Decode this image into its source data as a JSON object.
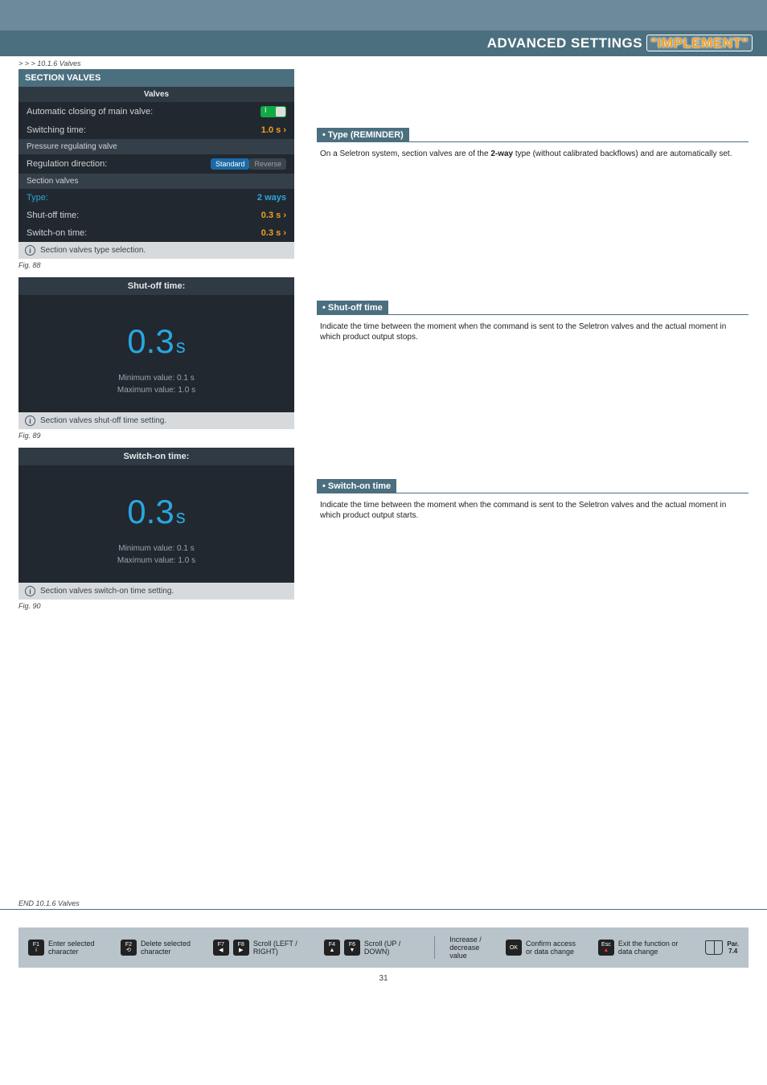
{
  "header": {
    "title_pre": "ADVANCED SETTINGS ",
    "title_impl": "\"IMPLEMENT\""
  },
  "breadcrumb": "> > > 10.1.6 Valves",
  "section_title": "SECTION VALVES",
  "panel": {
    "valves_hdr": "Valves",
    "auto_close": {
      "label": "Automatic closing of main valve:"
    },
    "switch_time": {
      "label": "Switching time:",
      "value": "1.0 s"
    },
    "prv_hdr": "Pressure regulating valve",
    "reg_dir": {
      "label": "Regulation direction:",
      "opt_on": "Standard",
      "opt_off": "Reverse"
    },
    "sv_hdr": "Section valves",
    "type": {
      "label": "Type:",
      "value": "2 ways"
    },
    "shutoff": {
      "label": "Shut-off time:",
      "value": "0.3 s"
    },
    "switchon": {
      "label": "Switch-on time:",
      "value": "0.3 s"
    },
    "info": "Section valves type selection."
  },
  "fig88": "Fig. 88",
  "popup_shutoff": {
    "title": "Shut-off time:",
    "value": "0.3",
    "unit": "s",
    "min": "Minimum value:  0.1 s",
    "max": "Maximum value:  1.0 s",
    "info": "Section valves shut-off time setting."
  },
  "fig89": "Fig. 89",
  "popup_switchon": {
    "title": "Switch-on time:",
    "value": "0.3",
    "unit": "s",
    "min": "Minimum value:  0.1 s",
    "max": "Maximum value:  1.0 s",
    "info": "Section valves switch-on time setting."
  },
  "fig90": "Fig. 90",
  "rhs": {
    "type": {
      "head": "Type (REMINDER)",
      "body_pre": "On a Seletron system, section valves are of the ",
      "body_bold": "2-way",
      "body_post": " type (without calibrated backflows) and are automatically set."
    },
    "shutoff": {
      "head": "Shut-off time",
      "body": "Indicate the time between the moment when the command is sent to the Seletron valves and the actual moment in which product output stops."
    },
    "switchon": {
      "head": "Switch-on time",
      "body": "Indicate the time between the moment when the command is sent to the Seletron valves and the actual moment in which product output starts."
    }
  },
  "endnote": "END 10.1.6 Valves",
  "footer": {
    "f1": {
      "key": "F1",
      "text": "Enter selected character"
    },
    "f2": {
      "key": "F2",
      "text": "Delete selected character"
    },
    "f78": {
      "k1": "F7",
      "k2": "F8",
      "text": "Scroll (LEFT / RIGHT)"
    },
    "f46": {
      "k1": "F4",
      "k2": "F6",
      "text": "Scroll (UP / DOWN)"
    },
    "incdec": {
      "text": "Increase / decrease value"
    },
    "ok": {
      "key": "OK",
      "text": "Confirm access or data change"
    },
    "esc": {
      "key": "Esc",
      "text": "Exit the function or data change"
    },
    "par": {
      "label": "Par.",
      "num": "7.4"
    }
  },
  "page_number": "31"
}
